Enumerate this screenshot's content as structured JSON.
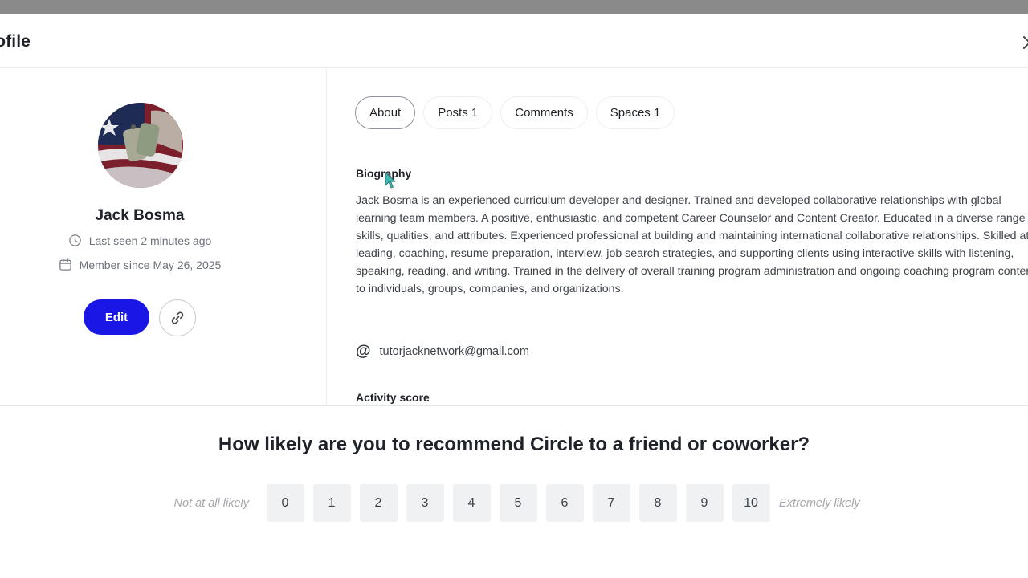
{
  "modal": {
    "title": "rofile"
  },
  "profile": {
    "name": "Jack Bosma",
    "last_seen": "Last seen 2 minutes ago",
    "member_since": "Member since May 26, 2025",
    "edit_label": "Edit",
    "icons": {
      "last_seen": "clock-icon",
      "member_since": "calendar-icon",
      "copy_link": "link-icon"
    }
  },
  "tabs": [
    {
      "label": "About",
      "active": true
    },
    {
      "label": "Posts 1",
      "active": false
    },
    {
      "label": "Comments",
      "active": false
    },
    {
      "label": "Spaces 1",
      "active": false
    }
  ],
  "about": {
    "biography_heading": "Biography",
    "biography_text": "Jack Bosma is an experienced curriculum developer and designer. Trained and developed collaborative relationships with global learning team members. A positive, enthusiastic, and competent Career Counselor and Content Creator. Educated in a diverse range of skills, qualities, and attributes. Experienced professional at building and maintaining international collaborative relationships. Skilled at leading, coaching, resume preparation, interview, job search strategies, and supporting clients using interactive skills with listening, speaking, reading, and writing. Trained in the delivery of overall training program administration and ongoing coaching program content to individuals, groups, companies, and organizations.",
    "email": "tutorjacknetwork@gmail.com",
    "email_icon": "@",
    "activity_heading": "Activity score"
  },
  "survey": {
    "question": "How likely are you to recommend Circle to a friend or coworker?",
    "low_label": "Not at all likely",
    "high_label": "Extremely likely",
    "scores": [
      "0",
      "1",
      "2",
      "3",
      "4",
      "5",
      "6",
      "7",
      "8",
      "9",
      "10"
    ]
  },
  "colors": {
    "accent": "#1a17e6",
    "top_strip": "#8a8a8a",
    "score_button_bg": "#f0f1f2"
  }
}
